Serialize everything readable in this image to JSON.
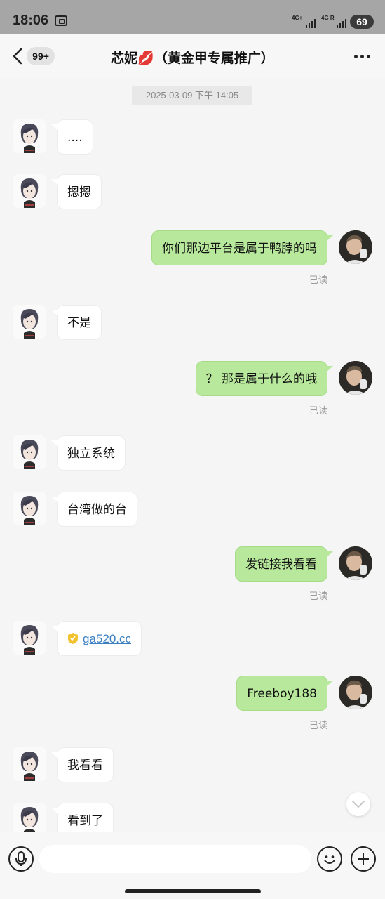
{
  "status_bar": {
    "time": "18:06",
    "signal_1": "4G+",
    "signal_2": "4G R",
    "battery": "69"
  },
  "header": {
    "unread_badge": "99+",
    "title": "芯妮💋（黄金甲专属推广）"
  },
  "chat": {
    "timestamp": "2025-03-09 下午 14:05",
    "read_label": "已读",
    "messages": [
      {
        "side": "left",
        "text": "...."
      },
      {
        "side": "left",
        "text": "摁摁"
      },
      {
        "side": "right",
        "text": "你们那边平台是属于鸭脖的吗"
      },
      {
        "side": "left",
        "text": "不是"
      },
      {
        "side": "right",
        "text": "？ 那是属于什么的哦"
      },
      {
        "side": "left",
        "text": "独立系统"
      },
      {
        "side": "left",
        "text": "台湾做的台"
      },
      {
        "side": "right",
        "text": "发链接我看看"
      },
      {
        "side": "left",
        "text": "ga520.cc",
        "is_link": true
      },
      {
        "side": "right",
        "text": "Freeboy188"
      },
      {
        "side": "left",
        "text": "我看看"
      },
      {
        "side": "left",
        "text": "看到了"
      }
    ]
  },
  "icons": {
    "back": "chevron-left-icon",
    "more": "more-dots-icon",
    "mic": "microphone-icon",
    "emoji": "emoji-icon",
    "plus": "plus-icon",
    "scroll": "chevron-down-icon",
    "link_safe": "shield-icon"
  },
  "colors": {
    "outgoing_bubble": "#b7e89b",
    "incoming_bubble": "#ffffff",
    "link": "#3a7fbf",
    "status_bar": "#a6a6a6"
  }
}
